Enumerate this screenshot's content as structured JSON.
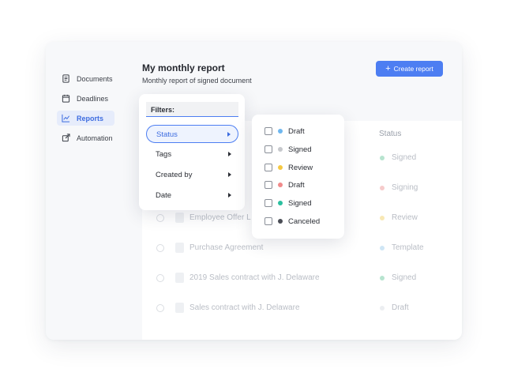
{
  "sidebar": {
    "items": [
      {
        "label": "Documents",
        "icon": "document-icon",
        "active": false
      },
      {
        "label": "Deadlines",
        "icon": "calendar-icon",
        "active": false
      },
      {
        "label": "Reports",
        "icon": "chart-line-icon",
        "active": true
      },
      {
        "label": "Automation",
        "icon": "external-edit-icon",
        "active": false
      }
    ]
  },
  "header": {
    "title": "My monthly report",
    "subtitle": "Monthly report of signed document",
    "create_button": "Create report"
  },
  "table": {
    "status_header": "Status",
    "rows": [
      {
        "name": "",
        "status": "Signed",
        "color": "#b7e4cf"
      },
      {
        "name": "",
        "status": "Signing",
        "color": "#f6cbcb"
      },
      {
        "name": "Employee Offer L",
        "status": "Review",
        "color": "#f8e8b4"
      },
      {
        "name": "Purchase Agreement",
        "status": "Template",
        "color": "#cfe6f5"
      },
      {
        "name": "2019 Sales contract with J. Delaware",
        "status": "Signed",
        "color": "#b7e4cf"
      },
      {
        "name": "Sales contract with J. Delaware",
        "status": "Draft",
        "color": "#eceef1"
      }
    ]
  },
  "filters": {
    "label": "Filters:",
    "items": [
      {
        "label": "Status",
        "active": true
      },
      {
        "label": "Tags",
        "active": false
      },
      {
        "label": "Created by",
        "active": false
      },
      {
        "label": "Date",
        "active": false
      }
    ]
  },
  "status_options": [
    {
      "label": "Draft",
      "color": "#6fb7ef"
    },
    {
      "label": "Signed",
      "color": "#c6c8cc"
    },
    {
      "label": "Review",
      "color": "#f5c842"
    },
    {
      "label": "Draft",
      "color": "#f08a8a"
    },
    {
      "label": "Signed",
      "color": "#2bbf9f"
    },
    {
      "label": "Canceled",
      "color": "#4a4d55"
    }
  ],
  "colors": {
    "accent": "#4d7ef2",
    "active_bg": "#e6ecfb"
  }
}
